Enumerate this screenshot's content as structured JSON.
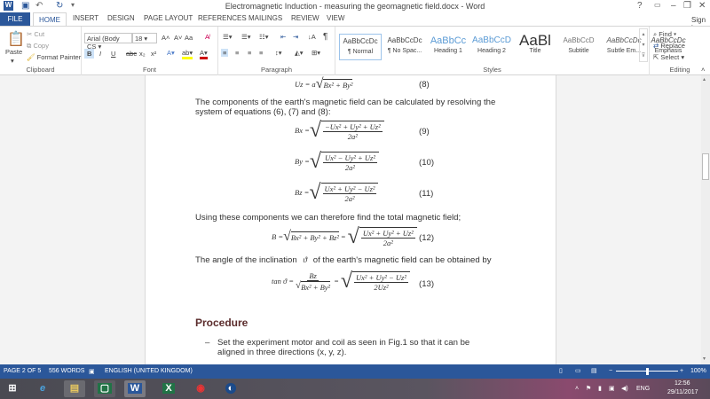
{
  "window": {
    "title": "Electromagnetic Induction - measuring the geomagnetic field.docx - Word",
    "sign_in": "Sign in",
    "help": "?",
    "minimize": "–",
    "restore": "❐",
    "close": "✕"
  },
  "tabs": [
    "FILE",
    "HOME",
    "INSERT",
    "DESIGN",
    "PAGE LAYOUT",
    "REFERENCES",
    "MAILINGS",
    "REVIEW",
    "VIEW"
  ],
  "clipboard": {
    "paste": "Paste",
    "cut": "Cut",
    "copy": "Copy",
    "format_painter": "Format Painter",
    "label": "Clipboard"
  },
  "font": {
    "name": "Arial (Body CS",
    "size": "18",
    "label": "Font",
    "bold": "B",
    "italic": "I",
    "underline": "U",
    "strike": "abc",
    "sub": "x₂",
    "sup": "x²",
    "grow": "A˄",
    "shrink": "A˅",
    "case": "Aa"
  },
  "paragraph": {
    "label": "Paragraph",
    "pilcrow": "¶"
  },
  "styles": {
    "label": "Styles",
    "items": [
      {
        "preview": "AaBbCcDc",
        "name": "¶ Normal"
      },
      {
        "preview": "AaBbCcDc",
        "name": "¶ No Spac..."
      },
      {
        "preview": "AaBbCc",
        "name": "Heading 1"
      },
      {
        "preview": "AaBbCcD",
        "name": "Heading 2"
      },
      {
        "preview": "AaBl",
        "name": "Title"
      },
      {
        "preview": "AaBbCcD",
        "name": "Subtitle"
      },
      {
        "preview": "AaBbCcDc",
        "name": "Subtle Em..."
      },
      {
        "preview": "AaBbCcDc",
        "name": "Emphasis"
      }
    ]
  },
  "editing": {
    "find": "Find",
    "replace": "Replace",
    "select": "Select",
    "label": "Editing"
  },
  "doc": {
    "eq8": {
      "lhs": "Uz = a",
      "rad": "Bx² + By²",
      "num": "(8)"
    },
    "p1": "The components of the earth's magnetic field can be calculated by resolving the system of equations (6), (7) and (8):",
    "eq9": {
      "lhs": "Bx =",
      "numer": "−Ux² + Uy² + Uz²",
      "denom": "2a²",
      "num": "(9)"
    },
    "eq10": {
      "lhs": "By =",
      "numer": "Ux² − Uy² + Uz²",
      "denom": "2a²",
      "num": "(10)"
    },
    "eq11": {
      "lhs": "Bz =",
      "numer": "Ux² + Uy² − Uz²",
      "denom": "2a²",
      "num": "(11)"
    },
    "p2": "Using these components we can therefore find the total magnetic field;",
    "eq12": {
      "lhs": "B =",
      "rad": "Bx² + By² + Bz²",
      "eq": "=",
      "numer": "Ux² + Uy² + Uz²",
      "denom": "2a²",
      "num": "(12)"
    },
    "p3a": "The angle of the inclination",
    "theta": "ϑ",
    "p3b": "of the earth's magnetic field can be obtained by",
    "eq13": {
      "lhs": "tan ϑ =",
      "fnum": "Bz",
      "frad": "Bx² + By²",
      "eq": "=",
      "numer": "Ux² + Uy² − Uz²",
      "denom": "2Uz²",
      "num": "(13)"
    },
    "heading": "Procedure",
    "bullet": "–",
    "b1": "Set the experiment motor and coil as seen in Fig.1 so that it can be aligned in three directions (x, y, z)."
  },
  "status": {
    "page": "PAGE 2 OF 5",
    "words": "556 WORDS",
    "language": "ENGLISH (UNITED KINGDOM)",
    "zoom": "100%",
    "zoom_fraction": 0.5
  },
  "taskbar": {
    "lang": "ENG",
    "time": "12:56",
    "date": "29/11/2017"
  }
}
